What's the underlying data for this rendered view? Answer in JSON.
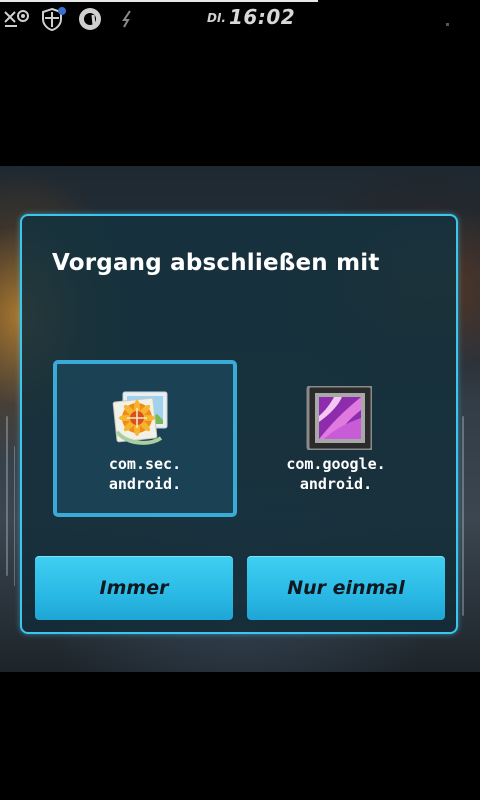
{
  "status_bar": {
    "icons": [
      "mail-at-icon",
      "shield-notification-icon",
      "circle-a-app-icon",
      "lightning-icon"
    ],
    "day": "DI.",
    "time": "16:02"
  },
  "dialog": {
    "title": "Vorgang abschließen mit",
    "apps": [
      {
        "icon": "gallery-sunflower-icon",
        "label_line1": "com.sec.",
        "label_line2": "android.",
        "selected": true
      },
      {
        "icon": "gallery-picture-frame-icon",
        "label_line1": "com.google.",
        "label_line2": "android.",
        "selected": false
      }
    ],
    "buttons": {
      "always_label": "Immer",
      "once_label": "Nur einmal"
    }
  },
  "colors": {
    "accent": "#3fc4ee",
    "button_fill": "#2cbbe6",
    "dialog_background": "#14323e",
    "status_bar_background": "#000000"
  }
}
